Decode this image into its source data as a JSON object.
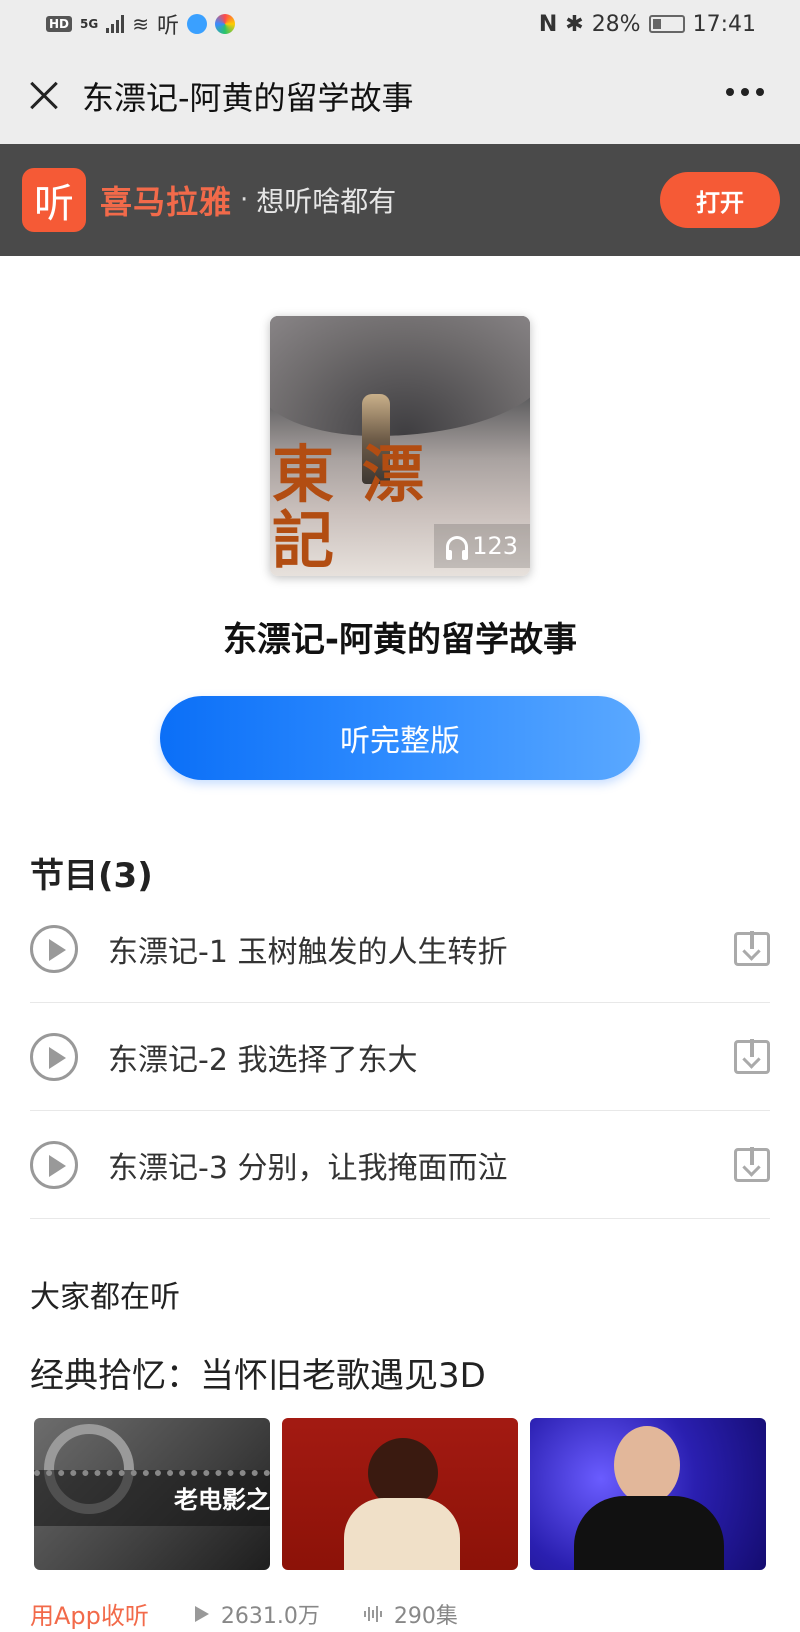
{
  "status_bar": {
    "hd": "HD",
    "network": "5G",
    "app_glyph": "听",
    "battery": "28%",
    "time": "17:41"
  },
  "title_bar": {
    "title": "东漂记-阿黄的留学故事",
    "close_icon": "close-icon",
    "more_icon": "more-icon"
  },
  "banner": {
    "logo_glyph": "听",
    "brand": "喜马拉雅",
    "dot": "·",
    "slogan": "想听啥都有",
    "open_label": "打开",
    "accent": "#f55a36"
  },
  "album": {
    "cover_text": "東漂記",
    "play_count": "123",
    "title": "东漂记-阿黄的留学故事",
    "listen_full_label": "听完整版"
  },
  "episodes": {
    "section_title": "节目(3)",
    "items": [
      {
        "title": "东漂记-1 玉树触发的人生转折"
      },
      {
        "title": "东漂记-2 我选择了东大"
      },
      {
        "title": "东漂记-3 分别，让我掩面而泣"
      }
    ]
  },
  "recommend": {
    "heading": "大家都在听",
    "playlist_title": "经典拾忆：当怀旧老歌遇见3D",
    "thumb1_label": "老电影之",
    "use_app": "用App收听",
    "plays": "2631.0万",
    "episodes_count": "290集"
  }
}
